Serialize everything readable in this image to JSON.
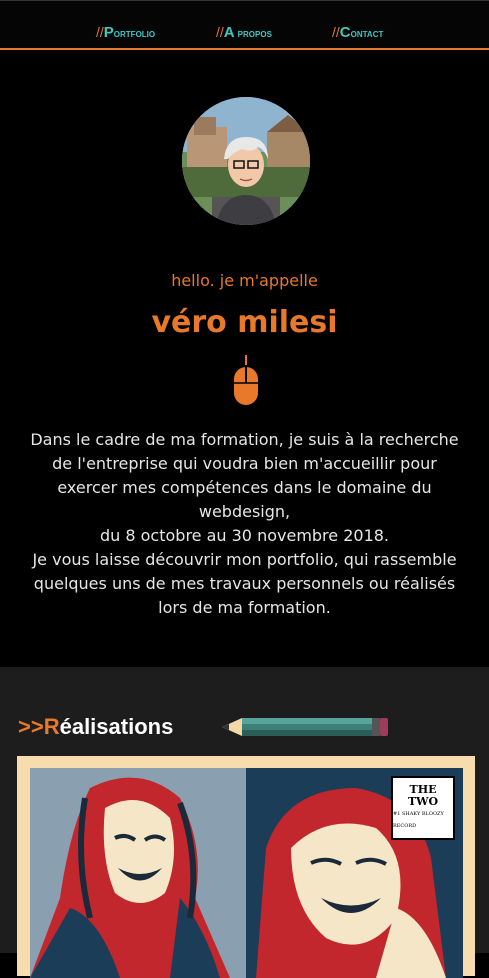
{
  "nav": {
    "items": [
      {
        "slash": "//",
        "first": "P",
        "rest": "ortfolio"
      },
      {
        "slash": "//",
        "first": "A",
        "rest": " propos"
      },
      {
        "slash": "//",
        "first": "C",
        "rest": "ontact"
      }
    ]
  },
  "hero": {
    "greeting": "hello. je m'appelle",
    "name": "véro milesi",
    "intro_lines": [
      "Dans le cadre de ma formation, je suis à la recherche de l'entreprise qui voudra bien m'accueillir pour exercer mes compétences dans le domaine du webdesign,",
      "du 8 octobre au 30 novembre 2018.",
      "Je vous laisse découvrir mon portfolio, qui rassemble quelques uns de mes travaux personnels ou réalisés lors de ma formation."
    ]
  },
  "works": {
    "arrows": ">>",
    "title_first": "R",
    "title_rest": "éalisations",
    "badge_line1": "THE",
    "badge_line2": "TWO",
    "badge_small": "#1 SHAKY BLOOZY RECORD"
  },
  "colors": {
    "accent": "#e8782a",
    "nav_text": "#3ec9c3",
    "background": "#000000",
    "section_bg": "#1d1d1d",
    "frame": "#f7ddad"
  }
}
